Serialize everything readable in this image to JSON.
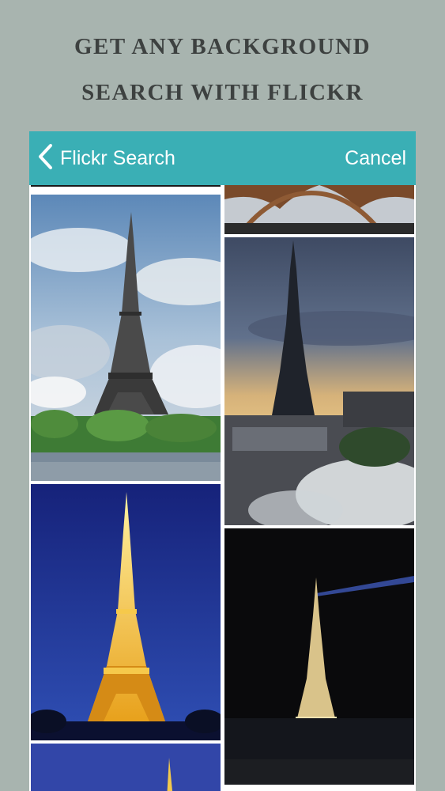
{
  "promo": {
    "line1": "GET ANY BACKGROUND",
    "line2": "SEARCH WITH FLICKR"
  },
  "navbar": {
    "back_icon": "chevron-left-icon",
    "title": "Flickr Search",
    "cancel_label": "Cancel",
    "color": "#3aafb5"
  },
  "results": {
    "left_column": [
      {
        "subject": "eiffel-tower-cropped"
      },
      {
        "subject": "eiffel-tower-day-cloudy-sky"
      },
      {
        "subject": "eiffel-tower-illuminated-night-blue-sky"
      },
      {
        "subject": "eiffel-tower-night-partial"
      }
    ],
    "right_column": [
      {
        "subject": "eiffel-tower-base-arches"
      },
      {
        "subject": "eiffel-tower-sunset-rooftops-smoke"
      },
      {
        "subject": "eiffel-tower-night-sparkle-beam"
      }
    ]
  }
}
